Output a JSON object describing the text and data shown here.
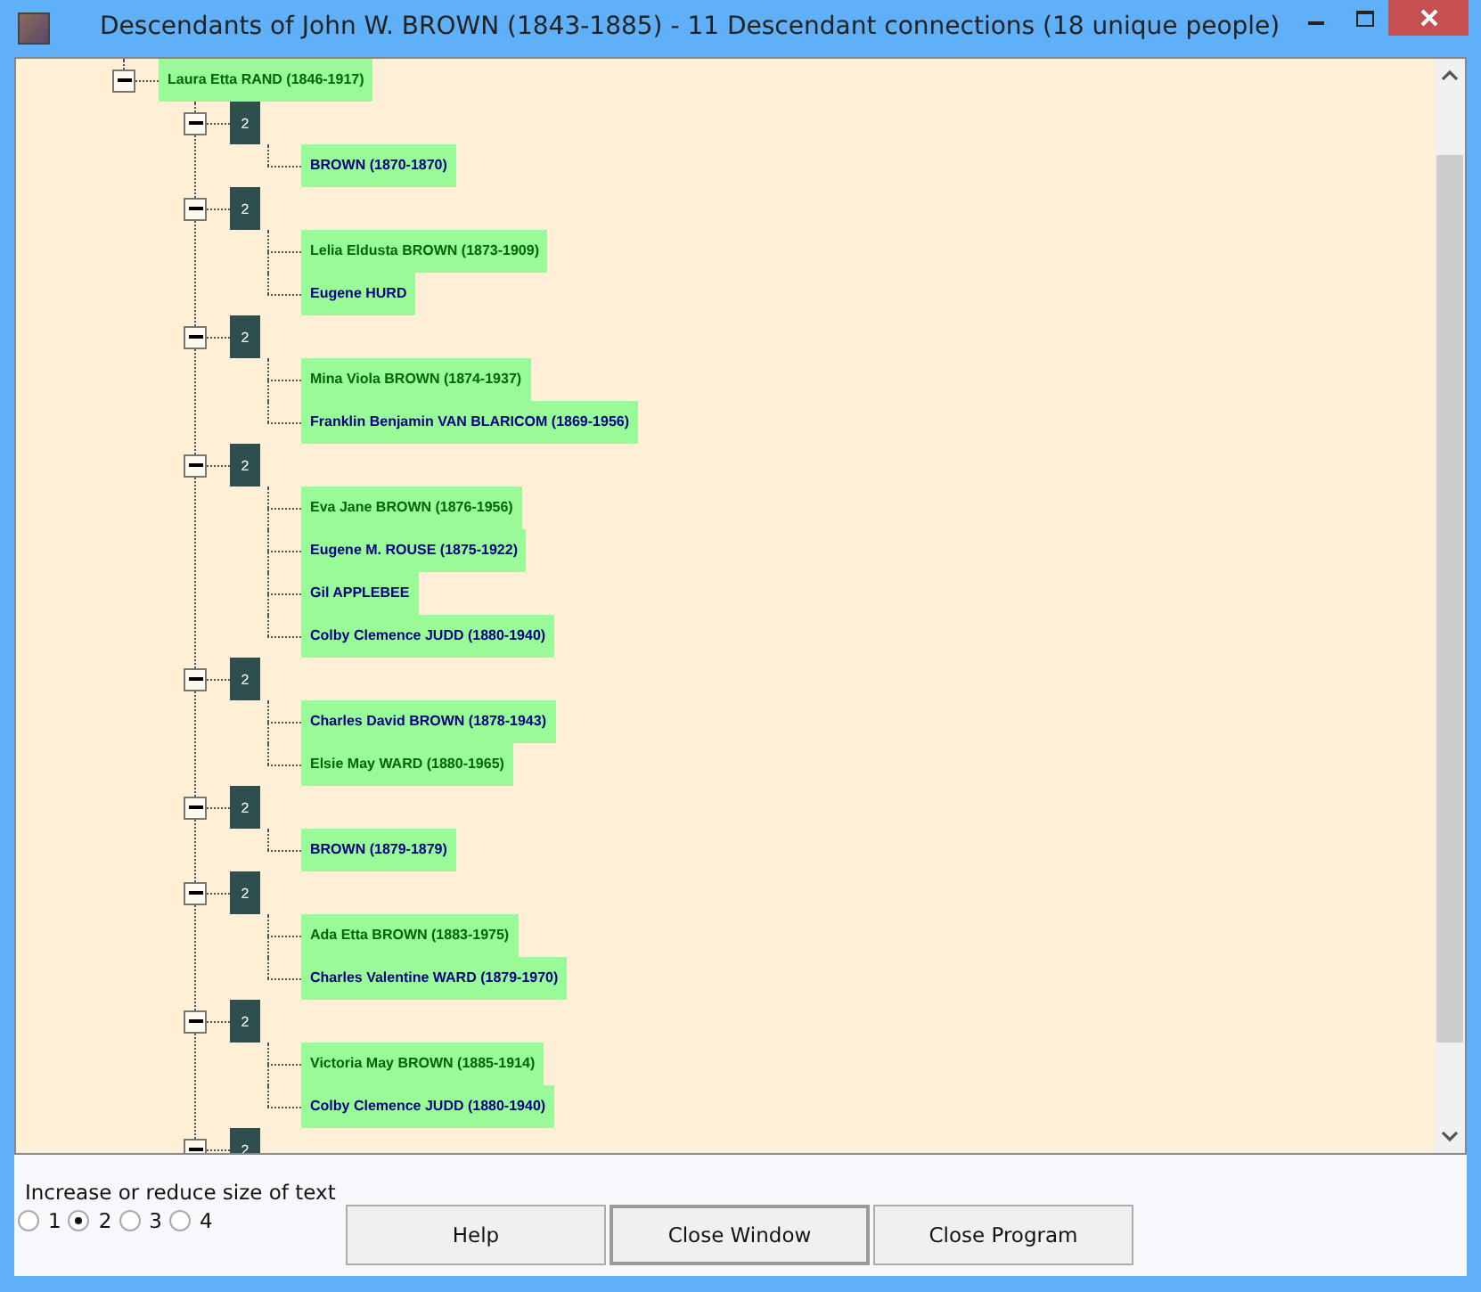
{
  "window": {
    "title": "Descendants of John W. BROWN (1843-1885) - 11 Descendant connections (18 unique people)"
  },
  "tree": {
    "root": {
      "name": "Laura Etta RAND (1846-1917)",
      "kind": "primary",
      "expanded": true,
      "children": [
        {
          "label": "2",
          "expanded": true,
          "children": [
            {
              "name": "BROWN (1870-1870)",
              "kind": "secondary"
            }
          ]
        },
        {
          "label": "2",
          "expanded": true,
          "children": [
            {
              "name": "Lelia Eldusta BROWN (1873-1909)",
              "kind": "primary"
            },
            {
              "name": "Eugene HURD",
              "kind": "secondary"
            }
          ]
        },
        {
          "label": "2",
          "expanded": true,
          "children": [
            {
              "name": "Mina Viola BROWN (1874-1937)",
              "kind": "primary"
            },
            {
              "name": "Franklin Benjamin VAN BLARICOM (1869-1956)",
              "kind": "secondary"
            }
          ]
        },
        {
          "label": "2",
          "expanded": true,
          "children": [
            {
              "name": "Eva Jane BROWN (1876-1956)",
              "kind": "primary"
            },
            {
              "name": "Eugene M. ROUSE (1875-1922)",
              "kind": "secondary"
            },
            {
              "name": "Gil APPLEBEE",
              "kind": "secondary"
            },
            {
              "name": "Colby Clemence JUDD (1880-1940)",
              "kind": "secondary"
            }
          ]
        },
        {
          "label": "2",
          "expanded": true,
          "children": [
            {
              "name": "Charles David BROWN (1878-1943)",
              "kind": "secondary"
            },
            {
              "name": "Elsie May WARD (1880-1965)",
              "kind": "primary"
            }
          ]
        },
        {
          "label": "2",
          "expanded": true,
          "children": [
            {
              "name": "BROWN (1879-1879)",
              "kind": "secondary"
            }
          ]
        },
        {
          "label": "2",
          "expanded": true,
          "children": [
            {
              "name": "Ada Etta BROWN (1883-1975)",
              "kind": "primary"
            },
            {
              "name": "Charles Valentine WARD (1879-1970)",
              "kind": "secondary"
            }
          ]
        },
        {
          "label": "2",
          "expanded": true,
          "children": [
            {
              "name": "Victoria May BROWN (1885-1914)",
              "kind": "primary"
            },
            {
              "name": "Colby Clemence JUDD (1880-1940)",
              "kind": "secondary"
            }
          ]
        },
        {
          "label": "2",
          "expanded": true
        }
      ]
    }
  },
  "text_size": {
    "label": "Increase or reduce size of text",
    "options": [
      {
        "label": "1",
        "selected": false
      },
      {
        "label": "2",
        "selected": true
      },
      {
        "label": "3",
        "selected": false
      },
      {
        "label": "4",
        "selected": false
      }
    ]
  },
  "buttons": [
    {
      "label": "Help",
      "default": false
    },
    {
      "label": "Close Window",
      "default": true
    },
    {
      "label": "Close Program",
      "default": false
    }
  ]
}
